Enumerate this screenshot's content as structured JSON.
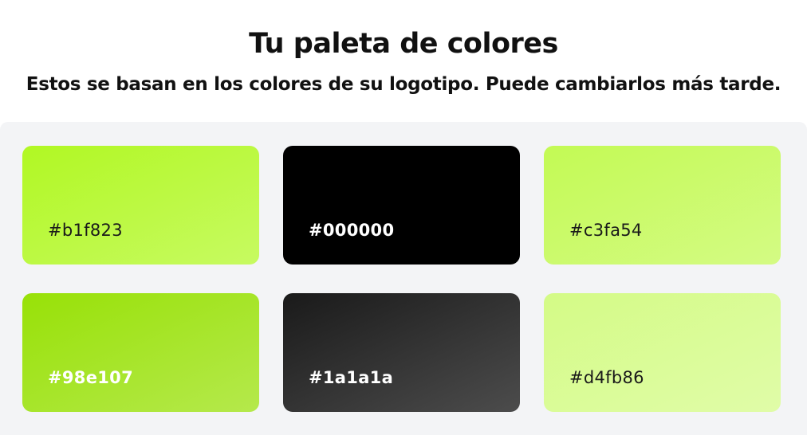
{
  "header": {
    "title": "Tu paleta de colores",
    "subtitle": "Estos se basan en los colores de su logotipo. Puede cambiarlos más tarde."
  },
  "palette": {
    "swatches": [
      {
        "label": "#b1f823",
        "color": "#b1f823",
        "text_color": "#1a1a1a",
        "text_weight": "normal"
      },
      {
        "label": "#000000",
        "color": "#000000",
        "text_color": "#ffffff",
        "text_weight": "bold"
      },
      {
        "label": "#c3fa54",
        "color": "#c3fa54",
        "text_color": "#1a1a1a",
        "text_weight": "normal"
      },
      {
        "label": "#98e107",
        "color": "#98e107",
        "text_color": "#ffffff",
        "text_weight": "bold"
      },
      {
        "label": "#1a1a1a",
        "color": "#1a1a1a",
        "text_color": "#ffffff",
        "text_weight": "bold"
      },
      {
        "label": "#d4fb86",
        "color": "#d4fb86",
        "text_color": "#1a1a1a",
        "text_weight": "normal"
      }
    ]
  }
}
